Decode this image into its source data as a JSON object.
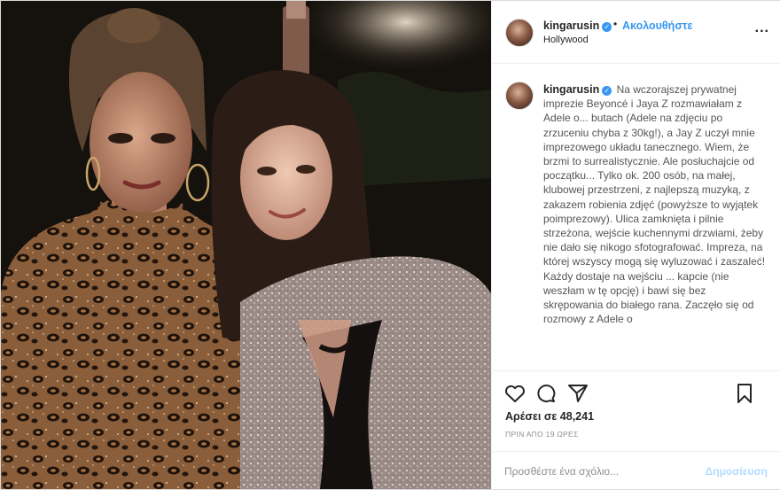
{
  "post": {
    "username": "kingarusin",
    "follow_separator": "•",
    "follow_label": "Ακολουθήστε",
    "location": "Hollywood",
    "more_label": "...",
    "verified_mark": "✓"
  },
  "caption": {
    "username": "kingarusin",
    "text": "Na wczorajszej prywatnej imprezie Beyoncé i Jaya Z rozmawiałam z Adele o... butach (Adele na zdjęciu po zrzuceniu chyba z 30kg!), a Jay Z uczył mnie imprezowego układu tanecznego. Wiem, że brzmi to surrealistycznie. Ale posłuchajcie od początku... Tylko ok. 200 osób, na małej, klubowej przestrzeni, z najlepszą muzyką, z zakazem robienia zdjęć (powyższe to wyjątek poimprezowy). Ulica zamknięta i pilnie strzeżona, wejście kuchennymi drzwiami, żeby nie dało się nikogo sfotografować. Impreza, na której wszyscy mogą się wyluzować i zaszaleć! Każdy dostaje na wejściu ... kapcie (nie weszłam w tę opcję) i bawi się bez skrępowania do białego rana. Zaczęło się od rozmowy z Adele o"
  },
  "actions": {
    "icons": [
      "heart-icon",
      "comment-icon",
      "share-icon",
      "bookmark-icon"
    ],
    "likes_text": "Αρέσει σε 48,241",
    "time_text": "ΠΡΙΝ ΑΠΟ 19 ΩΡΕΣ"
  },
  "comment": {
    "placeholder": "Προσθέστε ένα σχόλιο...",
    "post_label": "Δημοσίευση"
  },
  "colors": {
    "accent": "#3897f0",
    "post_disabled": "#b3dbff",
    "muted": "#8e8e8e",
    "border": "#efefef"
  }
}
